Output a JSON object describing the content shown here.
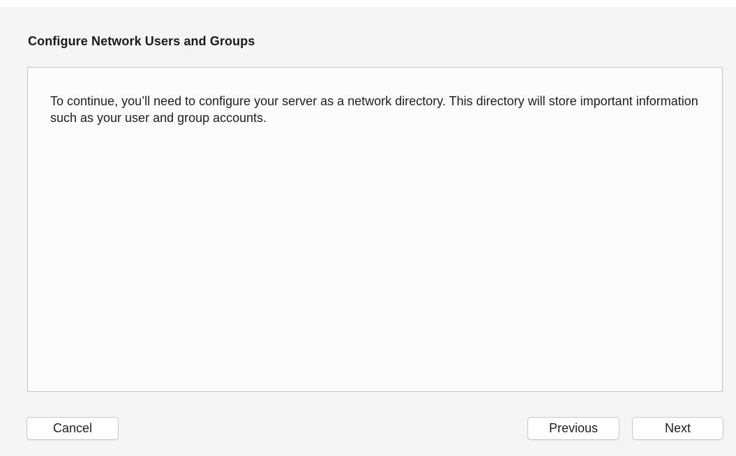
{
  "dialog": {
    "title": "Configure Network Users and Groups",
    "message": "To continue, you’ll need to configure your server as a network directory. This directory will store important information such as your user and group accounts."
  },
  "buttons": {
    "cancel_label": "Cancel",
    "previous_label": "Previous",
    "next_label": "Next"
  }
}
